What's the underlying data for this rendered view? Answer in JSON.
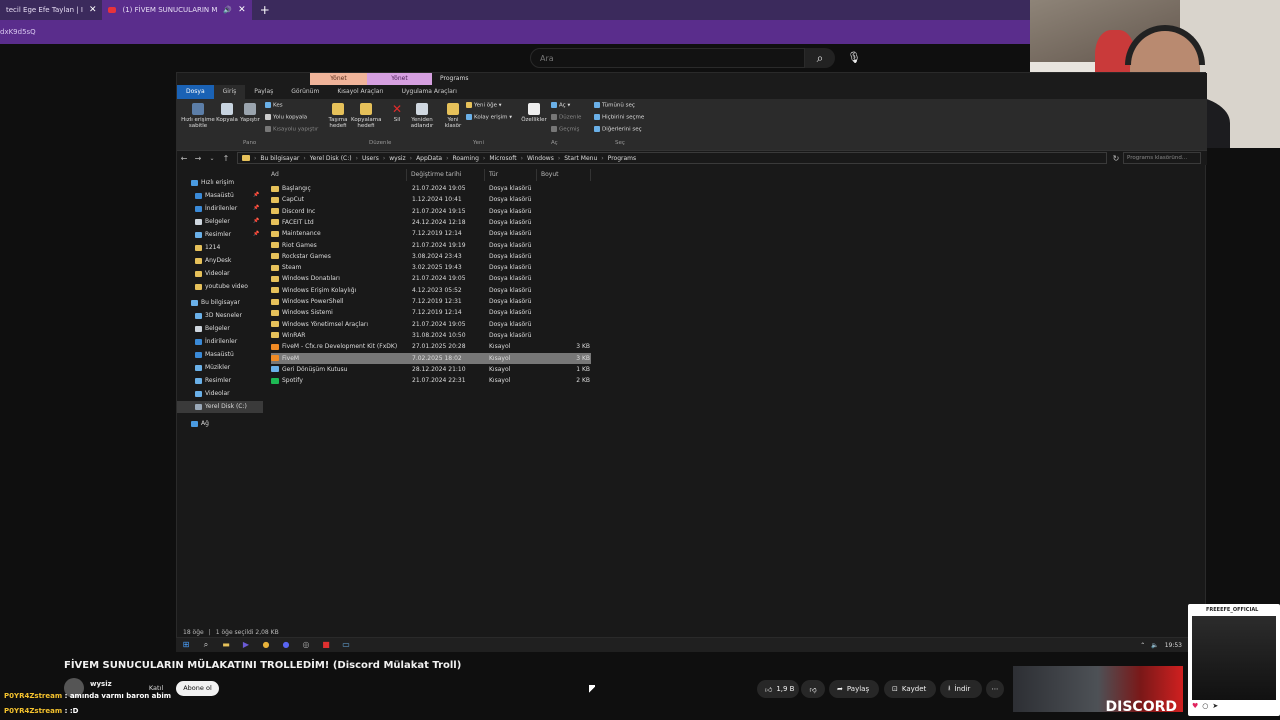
{
  "browser": {
    "tabs": [
      {
        "label": "tecil Ege Efe Taylan | I",
        "active": false
      },
      {
        "label": "(1) FİVEM SUNUCULARIN M",
        "active": true
      }
    ],
    "new_tab": "+",
    "url": "dxK9d5sQ"
  },
  "youtube": {
    "search_placeholder": "Ara",
    "video_title": "FİVEM SUNUCULARIN MÜLAKATINI TROLLEDİM! (Discord Mülakat Troll)",
    "channel": "wysiz",
    "join": "Katıl",
    "subscribe": "Abone ol",
    "likes": "1,9 B",
    "share": "Paylaş",
    "save": "Kaydet",
    "download": "İndir",
    "thumb_text": "DISCORD"
  },
  "chat": [
    {
      "user": "P0YR4Zstream",
      "msg": ": amında varmı baron abim"
    },
    {
      "user": "P0YR4Zstream",
      "msg": ": :D"
    }
  ],
  "explorer": {
    "context_tabs": [
      "Yönet",
      "Yönet",
      "Programs"
    ],
    "ribbon_tabs": [
      "Dosya",
      "Giriş",
      "Paylaş",
      "Görünüm",
      "Kısayol Araçları",
      "Uygulama Araçları"
    ],
    "ribbon": {
      "pin": "Hızlı erişime sabitle",
      "copy": "Kopyala",
      "paste": "Yapıştır",
      "cut": "Kes",
      "copy_path": "Yolu kopyala",
      "paste_shortcut": "Kısayolu yapıştır",
      "move_to": "Taşıma hedefi",
      "copy_to": "Kopyalama hedefi",
      "delete": "Sil",
      "rename": "Yeniden adlandır",
      "new_folder": "Yeni klasör",
      "new_item": "Yeni öğe",
      "easy_access": "Kolay erişim",
      "properties": "Özellikler",
      "open": "Aç",
      "edit": "Düzenle",
      "history": "Geçmiş",
      "select_all": "Tümünü seç",
      "select_none": "Hiçbirini seçme",
      "invert": "Diğerlerini seç",
      "groups": [
        "Pano",
        "Düzenle",
        "Yeni",
        "Aç",
        "Seç"
      ]
    },
    "breadcrumb": [
      "Bu bilgisayar",
      "Yerel Disk (C:)",
      "Users",
      "wysiz",
      "AppData",
      "Roaming",
      "Microsoft",
      "Windows",
      "Start Menu",
      "Programs"
    ],
    "search_placeholder": "Programs klasöründ...",
    "nav": [
      {
        "label": "Hızlı erişim",
        "color": "#4a9ae0",
        "pin": false
      },
      {
        "label": "Masaüstü",
        "color": "#3a8ad8",
        "pin": true
      },
      {
        "label": "İndirilenler",
        "color": "#3a8ad8",
        "pin": true
      },
      {
        "label": "Belgeler",
        "color": "#cfd6de",
        "pin": true
      },
      {
        "label": "Resimler",
        "color": "#6ab0e8",
        "pin": true
      },
      {
        "label": "1214",
        "color": "#e6c15a",
        "pin": false
      },
      {
        "label": "AnyDesk",
        "color": "#e6c15a",
        "pin": false
      },
      {
        "label": "Videolar",
        "color": "#e6c15a",
        "pin": false
      },
      {
        "label": "youtube video",
        "color": "#e6c15a",
        "pin": false
      },
      {
        "label": "Bu bilgisayar",
        "color": "#6ab0e8",
        "pin": false
      },
      {
        "label": "3D Nesneler",
        "color": "#6ab0e8",
        "pin": false
      },
      {
        "label": "Belgeler",
        "color": "#cfd6de",
        "pin": false
      },
      {
        "label": "İndirilenler",
        "color": "#3a8ad8",
        "pin": false
      },
      {
        "label": "Masaüstü",
        "color": "#3a8ad8",
        "pin": false
      },
      {
        "label": "Müzikler",
        "color": "#6ab0e8",
        "pin": false
      },
      {
        "label": "Resimler",
        "color": "#6ab0e8",
        "pin": false
      },
      {
        "label": "Videolar",
        "color": "#6ab0e8",
        "pin": false
      },
      {
        "label": "Yerel Disk (C:)",
        "color": "#9aa8b8",
        "pin": false
      },
      {
        "label": "Ağ",
        "color": "#4a9ae0",
        "pin": false
      }
    ],
    "columns": [
      "Ad",
      "Değiştirme tarihi",
      "Tür",
      "Boyut"
    ],
    "files": [
      {
        "name": "Başlangıç",
        "date": "21.07.2024 19:05",
        "type": "Dosya klasörü",
        "size": "",
        "icon": "#e6c15a"
      },
      {
        "name": "CapCut",
        "date": "1.12.2024 10:41",
        "type": "Dosya klasörü",
        "size": "",
        "icon": "#e6c15a"
      },
      {
        "name": "Discord Inc",
        "date": "21.07.2024 19:15",
        "type": "Dosya klasörü",
        "size": "",
        "icon": "#e6c15a"
      },
      {
        "name": "FACEIT Ltd",
        "date": "24.12.2024 12:18",
        "type": "Dosya klasörü",
        "size": "",
        "icon": "#e6c15a"
      },
      {
        "name": "Maintenance",
        "date": "7.12.2019 12:14",
        "type": "Dosya klasörü",
        "size": "",
        "icon": "#e6c15a"
      },
      {
        "name": "Riot Games",
        "date": "21.07.2024 19:19",
        "type": "Dosya klasörü",
        "size": "",
        "icon": "#e6c15a"
      },
      {
        "name": "Rockstar Games",
        "date": "3.08.2024 23:43",
        "type": "Dosya klasörü",
        "size": "",
        "icon": "#e6c15a"
      },
      {
        "name": "Steam",
        "date": "3.02.2025 19:43",
        "type": "Dosya klasörü",
        "size": "",
        "icon": "#e6c15a"
      },
      {
        "name": "Windows Donatıları",
        "date": "21.07.2024 19:05",
        "type": "Dosya klasörü",
        "size": "",
        "icon": "#e6c15a"
      },
      {
        "name": "Windows Erişim Kolaylığı",
        "date": "4.12.2023 05:52",
        "type": "Dosya klasörü",
        "size": "",
        "icon": "#e6c15a"
      },
      {
        "name": "Windows PowerShell",
        "date": "7.12.2019 12:31",
        "type": "Dosya klasörü",
        "size": "",
        "icon": "#e6c15a"
      },
      {
        "name": "Windows Sistemi",
        "date": "7.12.2019 12:14",
        "type": "Dosya klasörü",
        "size": "",
        "icon": "#e6c15a"
      },
      {
        "name": "Windows Yönetimsel Araçları",
        "date": "21.07.2024 19:05",
        "type": "Dosya klasörü",
        "size": "",
        "icon": "#e6c15a"
      },
      {
        "name": "WinRAR",
        "date": "31.08.2024 10:50",
        "type": "Dosya klasörü",
        "size": "",
        "icon": "#e6c15a"
      },
      {
        "name": "FiveM - Cfx.re Development Kit (FxDK)",
        "date": "27.01.2025 20:28",
        "type": "Kısayol",
        "size": "3 KB",
        "icon": "#f08a24"
      },
      {
        "name": "FiveM",
        "date": "7.02.2025 18:02",
        "type": "Kısayol",
        "size": "3 KB",
        "icon": "#f08a24",
        "selected": true
      },
      {
        "name": "Geri Dönüşüm Kutusu",
        "date": "28.12.2024 21:10",
        "type": "Kısayol",
        "size": "1 KB",
        "icon": "#6ab0e8"
      },
      {
        "name": "Spotify",
        "date": "21.07.2024 22:31",
        "type": "Kısayol",
        "size": "2 KB",
        "icon": "#1db954"
      }
    ],
    "status": [
      "18 öğe",
      "1 öğe seçildi  2,08 KB"
    ]
  },
  "taskbar": {
    "clock": "19:53"
  },
  "instagram": {
    "name": "FREEEFE_OFFICIAL"
  }
}
